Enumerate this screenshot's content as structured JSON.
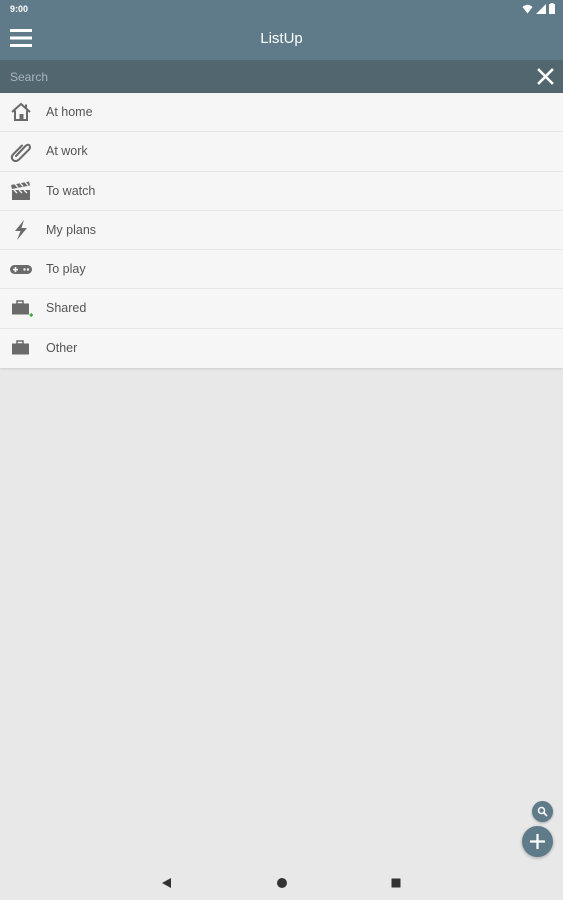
{
  "status_bar": {
    "time": "9:00",
    "icons": [
      "wifi-icon",
      "signal-icon",
      "battery-icon"
    ]
  },
  "app_bar": {
    "title": "ListUp",
    "menu_icon": "hamburger-menu-icon"
  },
  "search": {
    "placeholder": "Search",
    "value": "",
    "close_icon": "close-icon"
  },
  "lists": [
    {
      "label": "At home",
      "icon": "house-icon"
    },
    {
      "label": "At work",
      "icon": "paperclip-icon"
    },
    {
      "label": "To watch",
      "icon": "clapperboard-icon"
    },
    {
      "label": "My plans",
      "icon": "lightning-icon"
    },
    {
      "label": "To play",
      "icon": "gamepad-icon"
    },
    {
      "label": "Shared",
      "icon": "shared-folder-icon"
    },
    {
      "label": "Other",
      "icon": "briefcase-icon"
    }
  ],
  "fabs": {
    "search_icon": "search-icon",
    "add_icon": "plus-icon"
  },
  "nav_bar": {
    "icons": [
      "back-icon",
      "home-icon",
      "recents-icon"
    ]
  },
  "colors": {
    "toolbar": "#5f7b8a",
    "search_bar": "#51666f",
    "background": "#e8e8e8",
    "list_background": "#f6f6f6",
    "icon_gray": "#6a6a6a",
    "shared_accent": "#3caa3c"
  }
}
